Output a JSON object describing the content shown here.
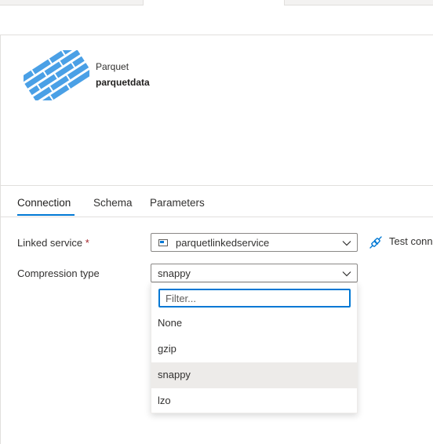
{
  "dataset": {
    "type_label": "Parquet",
    "name": "parquetdata"
  },
  "tabs": [
    {
      "label": "Connection",
      "active": true
    },
    {
      "label": "Schema",
      "active": false
    },
    {
      "label": "Parameters",
      "active": false
    }
  ],
  "form": {
    "linked_service": {
      "label": "Linked service",
      "required_marker": "*",
      "value": "parquetlinkedservice",
      "test_connection_label": "Test connection"
    },
    "compression_type": {
      "label": "Compression type",
      "value": "snappy"
    }
  },
  "dropdown": {
    "filter_placeholder": "Filter...",
    "options": [
      "None",
      "gzip",
      "snappy",
      "lzo"
    ],
    "selected": "snappy"
  },
  "colors": {
    "accent": "#0078d4",
    "logo": "#4aa0e6",
    "selected_row": "#edebe9",
    "required": "#a4262c"
  },
  "icons": [
    "parquet-logo",
    "linked-service-icon",
    "chevron-down-icon",
    "plug-icon"
  ]
}
